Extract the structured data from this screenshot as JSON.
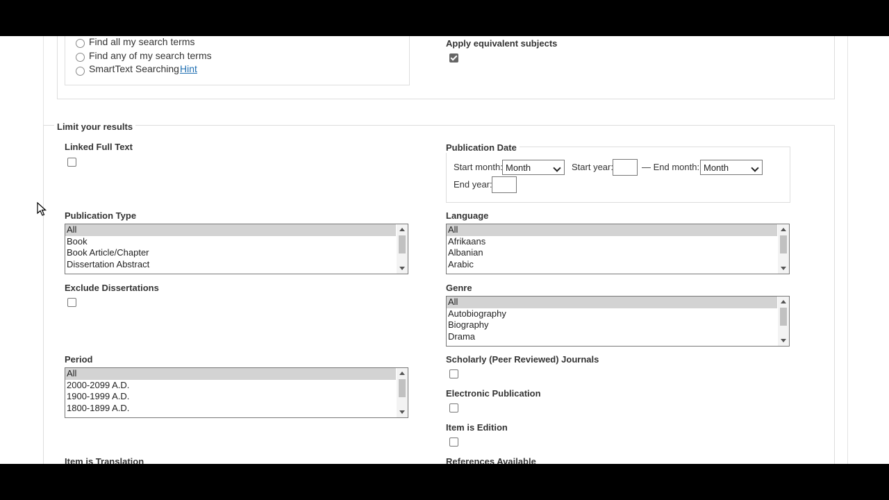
{
  "search_options": {
    "radios": [
      {
        "label": "Find all my search terms"
      },
      {
        "label": "Find any of my search terms"
      },
      {
        "label": "SmartText Searching"
      }
    ],
    "hint_link": "Hint",
    "apply_equivalent_label": "Apply equivalent subjects"
  },
  "limits": {
    "legend": "Limit your results",
    "linked_full_text": "Linked Full Text",
    "publication_date": {
      "legend": "Publication Date",
      "start_month_label": "Start month:",
      "start_month_value": "Month",
      "start_year_label": "Start year:",
      "end_month_label": "— End month:",
      "end_month_value": "Month",
      "end_year_label": "End year:"
    },
    "publication_type": {
      "label": "Publication Type",
      "options": [
        "All",
        "Book",
        "Book Article/Chapter",
        "Dissertation Abstract"
      ]
    },
    "language": {
      "label": "Language",
      "options": [
        "All",
        "Afrikaans",
        "Albanian",
        "Arabic"
      ]
    },
    "exclude_dissertations": "Exclude Dissertations",
    "genre": {
      "label": "Genre",
      "options": [
        "All",
        "Autobiography",
        "Biography",
        "Drama"
      ]
    },
    "period": {
      "label": "Period",
      "options": [
        "All",
        "2000-2099 A.D.",
        "1900-1999 A.D.",
        "1800-1899 A.D."
      ]
    },
    "scholarly": "Scholarly (Peer Reviewed) Journals",
    "electronic_publication": "Electronic Publication",
    "item_is_edition": "Item is Edition",
    "item_is_translation": "Item is Translation",
    "references_available": "References Available"
  }
}
